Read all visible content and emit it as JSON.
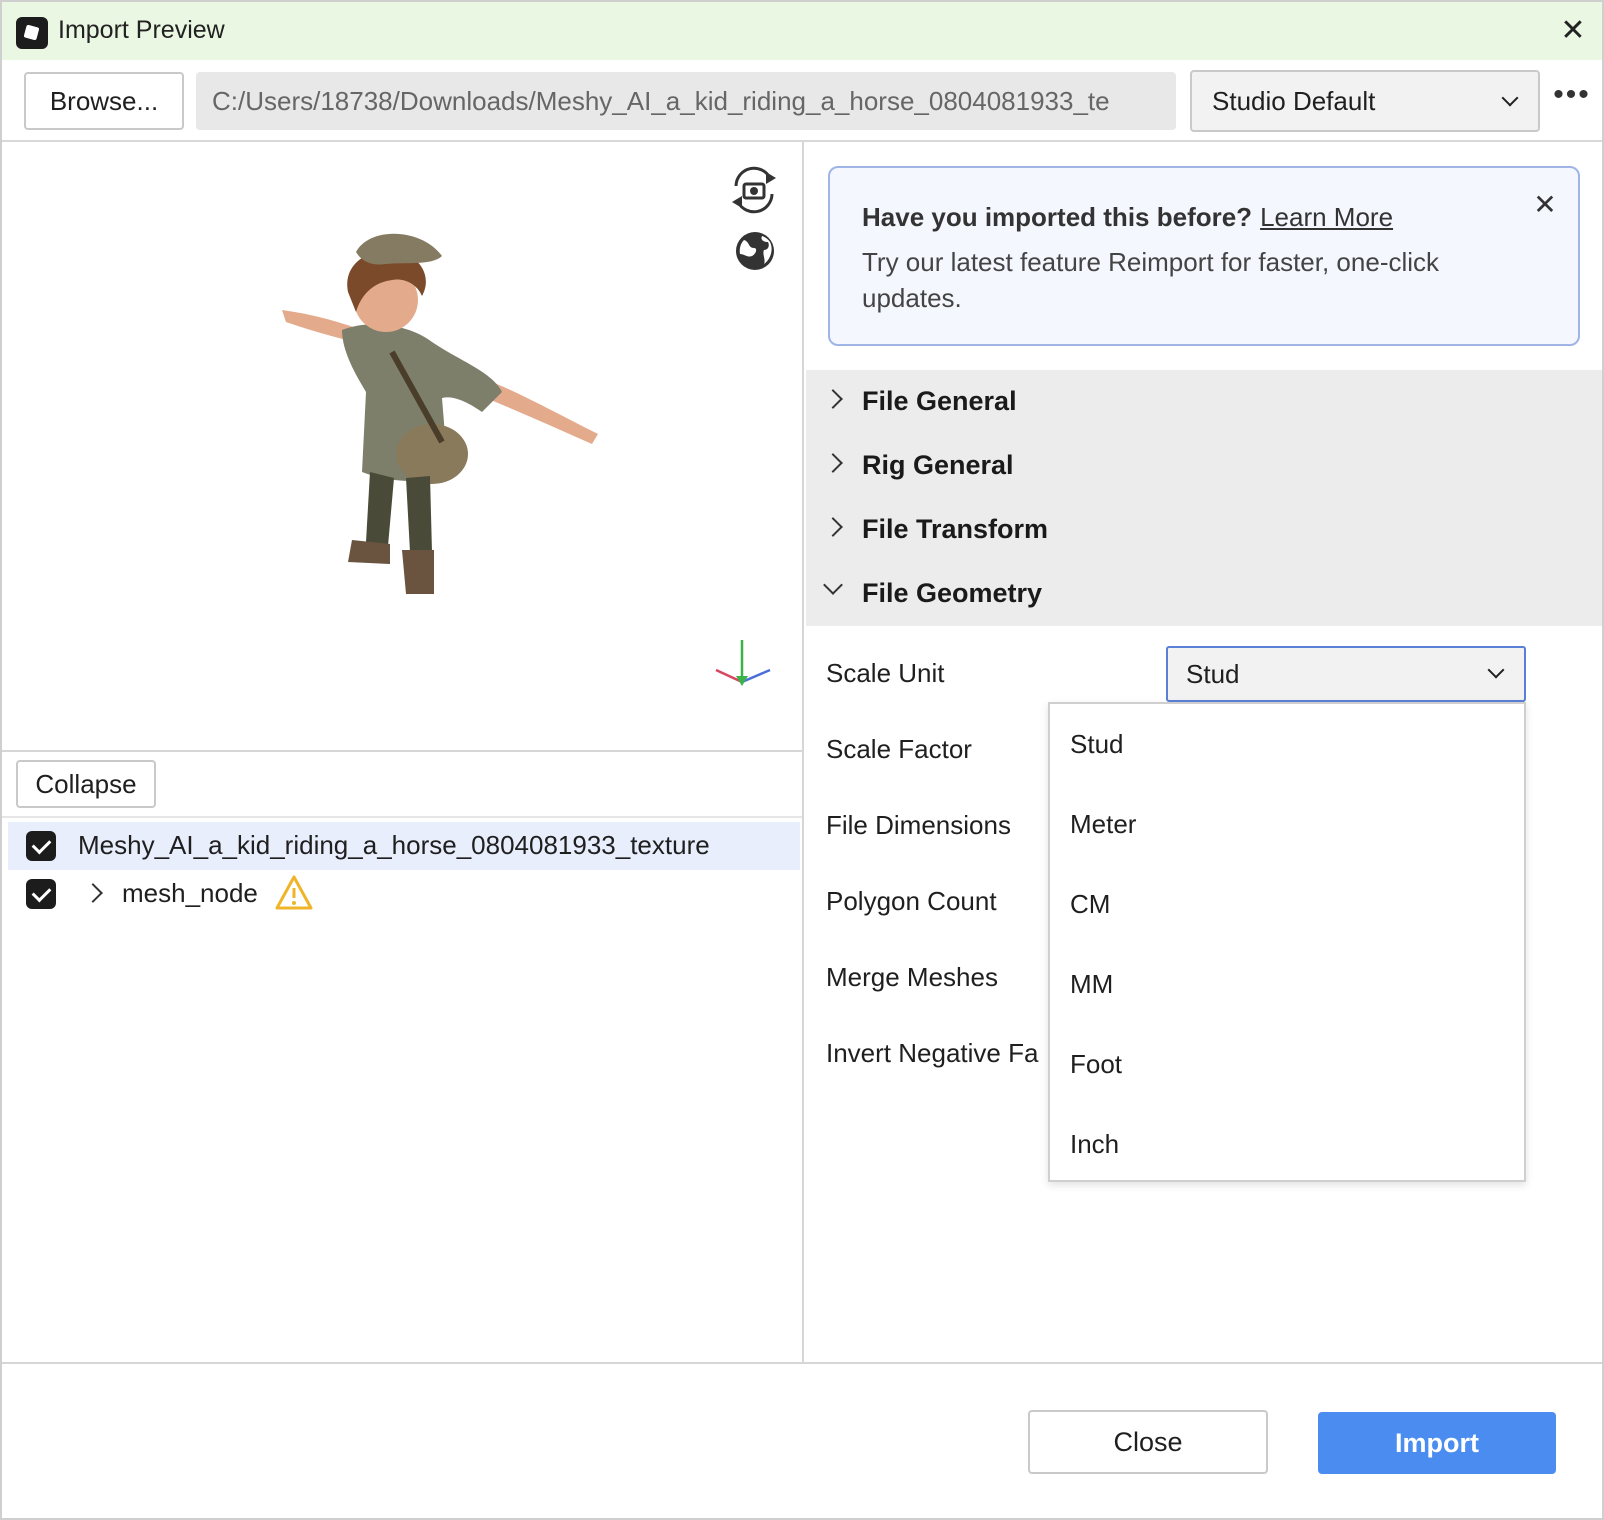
{
  "window": {
    "title": "Import Preview",
    "close_icon": "close-icon"
  },
  "toolbar": {
    "browse_label": "Browse...",
    "file_path": "C:/Users/18738/Downloads/Meshy_AI_a_kid_riding_a_horse_0804081933_te",
    "preset_value": "Studio Default",
    "more_icon": "more-horizontal-icon"
  },
  "viewport": {
    "icons": [
      "camera-rotate-icon",
      "globe-icon",
      "axes-gizmo-icon"
    ],
    "model_description_icon": "character-model"
  },
  "tree": {
    "collapse_label": "Collapse",
    "items": [
      {
        "label": "Meshy_AI_a_kid_riding_a_horse_0804081933_texture",
        "checked": true,
        "selected": true
      },
      {
        "label": "mesh_node",
        "checked": true,
        "has_warning": true
      }
    ]
  },
  "banner": {
    "title": "Have you imported this before?",
    "link": "Learn More",
    "text": "Try our latest feature Reimport for faster, one-click updates."
  },
  "sections": [
    {
      "label": "File General",
      "open": false
    },
    {
      "label": "Rig General",
      "open": false
    },
    {
      "label": "File Transform",
      "open": false
    },
    {
      "label": "File Geometry",
      "open": true
    }
  ],
  "geometry": {
    "properties": [
      "Scale Unit",
      "Scale Factor",
      "File Dimensions",
      "Polygon Count",
      "Merge Meshes",
      "Invert Negative Fa"
    ],
    "scale_unit_value": "Stud",
    "scale_unit_options": [
      "Stud",
      "Meter",
      "CM",
      "MM",
      "Foot",
      "Inch"
    ]
  },
  "footer": {
    "close_label": "Close",
    "import_label": "Import"
  },
  "colors": {
    "titlebar_bg": "#eaf7e3",
    "accent": "#4a8cf0",
    "banner_border": "#9fb5e6",
    "selected_row": "#e8eefc"
  }
}
